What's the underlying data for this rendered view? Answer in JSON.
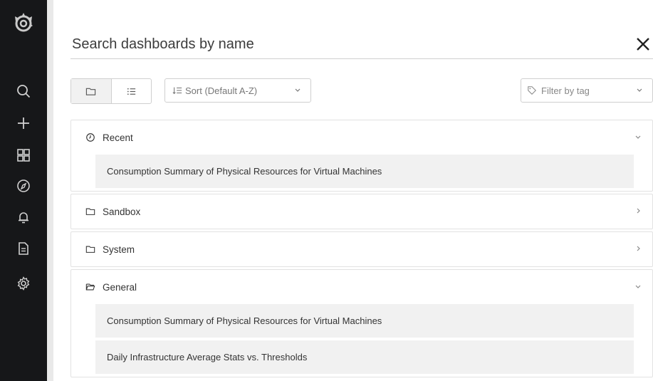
{
  "sidebar": {
    "logo": "grafana-logo",
    "items": [
      {
        "icon": "search-icon"
      },
      {
        "icon": "plus-icon"
      },
      {
        "icon": "dashboards-grid-icon"
      },
      {
        "icon": "compass-icon"
      },
      {
        "icon": "bell-icon"
      },
      {
        "icon": "document-icon"
      },
      {
        "icon": "gear-icon"
      }
    ]
  },
  "search": {
    "placeholder": "Search dashboards by name",
    "close_icon": "close-icon"
  },
  "toolbar": {
    "layout_folder_icon": "folder-icon",
    "layout_list_icon": "list-icon",
    "sort_label": "Sort (Default A-Z)",
    "tag_filter_label": "Filter by tag"
  },
  "sections": [
    {
      "label": "Recent",
      "icon": "clock-icon",
      "expanded": true,
      "items": [
        "Consumption Summary of Physical Resources for Virtual Machines"
      ]
    },
    {
      "label": "Sandbox",
      "icon": "folder-icon",
      "expanded": false,
      "items": []
    },
    {
      "label": "System",
      "icon": "folder-icon",
      "expanded": false,
      "items": []
    },
    {
      "label": "General",
      "icon": "folder-open-icon",
      "expanded": true,
      "items": [
        "Consumption Summary of Physical Resources for Virtual Machines",
        "Daily Infrastructure Average Stats vs. Thresholds"
      ]
    }
  ],
  "colors": {
    "sidebar_bg": "#161719",
    "item_bg": "#f1f1f1",
    "border": "#e2e2e2"
  }
}
